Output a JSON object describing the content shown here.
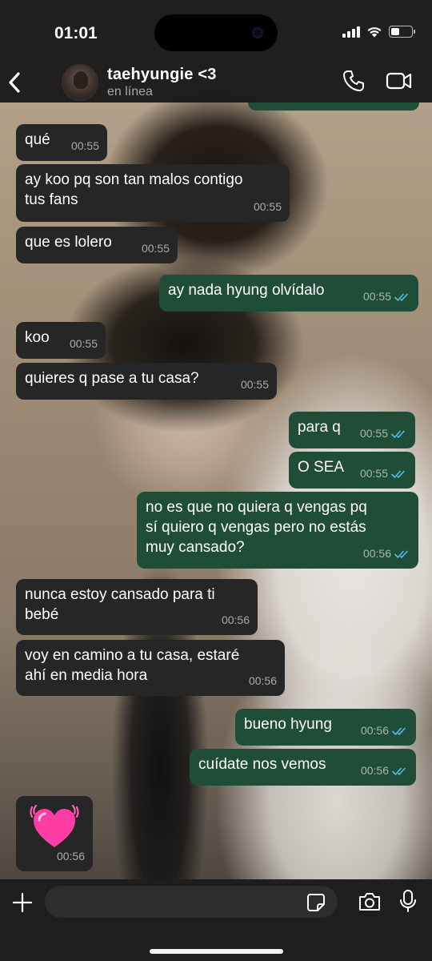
{
  "status_bar": {
    "time": "01:01"
  },
  "header": {
    "back_icon": "chevron-left-icon",
    "contact_name": "taehyungie <3",
    "contact_status": "en línea",
    "call_icon": "phone-icon",
    "video_icon": "video-camera-icon"
  },
  "messages": [
    {
      "dir": "in",
      "text": "qué",
      "time": "00:55"
    },
    {
      "dir": "in",
      "text": "ay koo pq son tan malos contigo\ntus fans",
      "time": "00:55"
    },
    {
      "dir": "in",
      "text": "que es lolero",
      "time": "00:55"
    },
    {
      "dir": "out",
      "text": "ay nada hyung olvídalo",
      "time": "00:55",
      "read": true
    },
    {
      "dir": "in",
      "text": "koo",
      "time": "00:55"
    },
    {
      "dir": "in",
      "text": "quieres q pase a tu casa?",
      "time": "00:55"
    },
    {
      "dir": "out",
      "text": "para q",
      "time": "00:55",
      "read": true
    },
    {
      "dir": "out",
      "text": "O SEA",
      "time": "00:55",
      "read": true
    },
    {
      "dir": "out",
      "text": "no es que no quiera q vengas pq\nsí quiero q vengas pero no estás\nmuy cansado?",
      "time": "00:56",
      "read": true
    },
    {
      "dir": "in",
      "text": "nunca estoy cansado para ti\nbebé",
      "time": "00:56"
    },
    {
      "dir": "in",
      "text": "voy en camino a tu casa, estaré\nahí en media hora",
      "time": "00:56"
    },
    {
      "dir": "out",
      "text": "bueno hyung",
      "time": "00:56",
      "read": true
    },
    {
      "dir": "out",
      "text": "cuídate nos vemos",
      "time": "00:56",
      "read": true
    },
    {
      "dir": "in",
      "sticker": "beating-pink-heart",
      "time": "00:56"
    }
  ],
  "composer": {
    "plus_icon": "plus-icon",
    "input_value": "",
    "sticker_icon": "sticker-icon",
    "camera_icon": "camera-icon",
    "mic_icon": "microphone-icon"
  },
  "colors": {
    "incoming_bubble": "#262626",
    "outgoing_bubble": "#1f4d38",
    "read_ticks": "#53bdeb"
  }
}
